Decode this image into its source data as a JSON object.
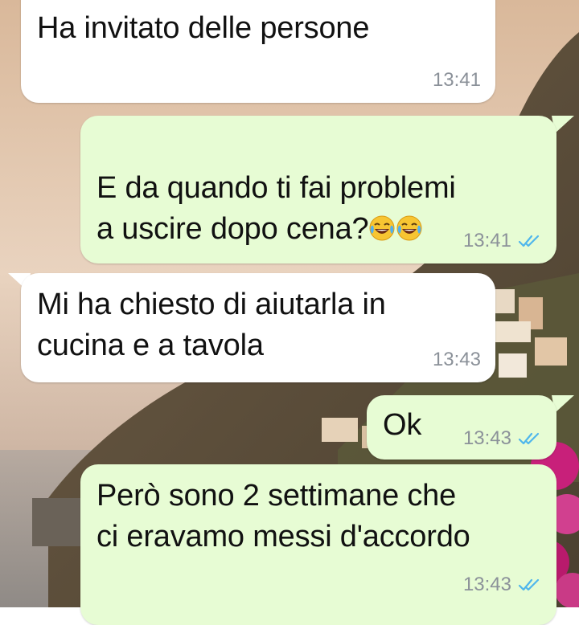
{
  "chat": {
    "messages": [
      {
        "direction": "incoming",
        "text": "Ha invitato delle persone",
        "time": "13:41"
      },
      {
        "direction": "outgoing",
        "text": "E da quando ti fai problemi\na uscire dopo cena?",
        "emoji": [
          "face-with-tears-of-joy-emoji",
          "face-with-tears-of-joy-emoji"
        ],
        "time": "13:41",
        "status": "read"
      },
      {
        "direction": "incoming",
        "text": "Mi ha chiesto di aiutarla in\ncucina e a tavola",
        "time": "13:43"
      },
      {
        "direction": "outgoing",
        "text": "Ok",
        "time": "13:43",
        "status": "read"
      },
      {
        "direction": "outgoing",
        "text": "Però sono 2 settimane che\nci eravamo messi d'accordo",
        "time": "13:43",
        "status": "read"
      }
    ]
  },
  "colors": {
    "incoming_bubble": "#ffffff",
    "outgoing_bubble": "#e7fcd4",
    "read_ticks": "#4fb6ec",
    "timestamp": "#8b9199"
  }
}
